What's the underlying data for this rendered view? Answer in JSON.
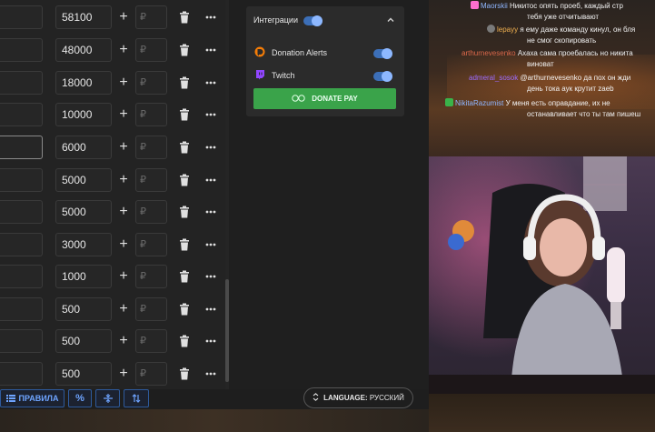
{
  "rows": [
    {
      "amount": "58100",
      "currency": "₽"
    },
    {
      "amount": "48000",
      "currency": "₽"
    },
    {
      "amount": "18000",
      "currency": "₽"
    },
    {
      "amount": "10000",
      "currency": "₽"
    },
    {
      "amount": "6000",
      "currency": "₽"
    },
    {
      "amount": "5000",
      "currency": "₽"
    },
    {
      "amount": "5000",
      "currency": "₽"
    },
    {
      "amount": "3000",
      "currency": "₽"
    },
    {
      "amount": "1000",
      "currency": "₽"
    },
    {
      "amount": "500",
      "currency": "₽"
    },
    {
      "amount": "500",
      "currency": "₽"
    },
    {
      "amount": "500",
      "currency": "₽"
    }
  ],
  "integrations": {
    "title": "Интеграции",
    "items": [
      {
        "label": "Donation Alerts",
        "icon": "donation-alerts-icon",
        "enabled": true
      },
      {
        "label": "Twitch",
        "icon": "twitch-icon",
        "enabled": true
      }
    ],
    "button_label": "DONATE PAY"
  },
  "toolbar": {
    "rules_label": "ПРАВИЛА",
    "percent_label": "%"
  },
  "language": {
    "prefix": "LANGUAGE:",
    "value": "РУССКИЙ"
  },
  "chat": [
    {
      "user": "Maorskii",
      "user_color": "#8fb6ff",
      "text": "Никитос опять проеб, каждый стр",
      "cont": "тебя уже отчитывают"
    },
    {
      "user": "lepayy",
      "user_color": "#f0b050",
      "text": "я ему даже команду кинул, он бля",
      "cont": "не смог скопировать"
    },
    {
      "user": "arthurnevesenko",
      "user_color": "#e06a4a",
      "text": "Ахаха сама проебалась но никита",
      "cont": "виноват"
    },
    {
      "user": "admeral_sosok",
      "user_color": "#9b6bff",
      "text": "@arthurnevesenko да пох он жди",
      "cont": "день тока аук крутит zaeb"
    },
    {
      "user": "NikitaRazumist",
      "user_color": "#8fb6ff",
      "text": "У меня есть оправдание, их не",
      "cont": "останавливает что ты там пишеш"
    }
  ],
  "colors": {
    "accent": "#3c6fb8",
    "donate_green": "#3aa34a",
    "rules_blue": "#6ea4ff"
  }
}
